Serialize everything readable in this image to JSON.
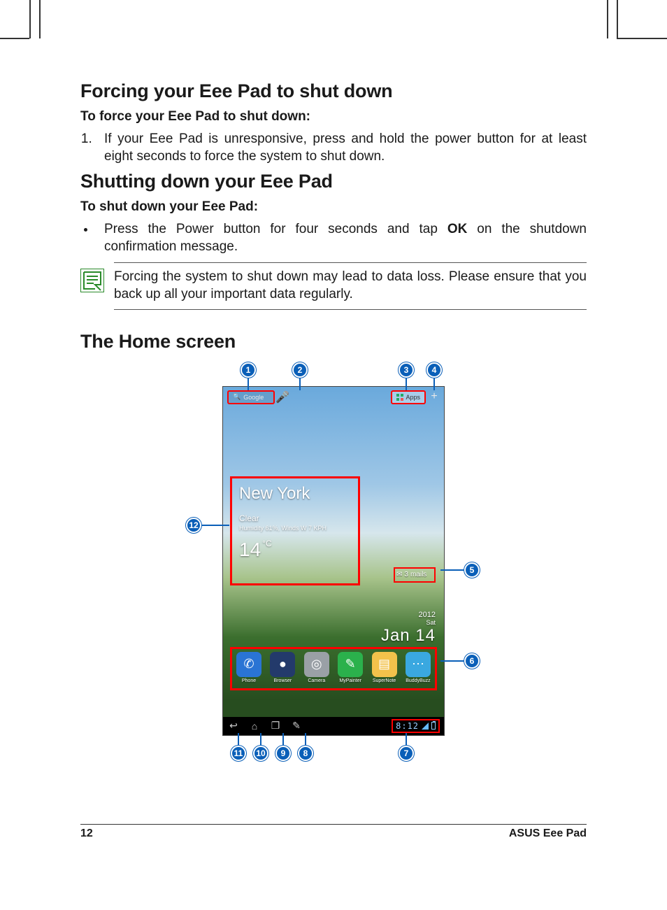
{
  "headings": {
    "forcing": "Forcing your Eee Pad to shut down",
    "force_sub": "To force your Eee Pad to shut down:",
    "shutting": "Shutting down your Eee Pad",
    "shut_sub": "To shut down your Eee Pad:",
    "home": "The Home screen"
  },
  "body": {
    "force_item": "If your Eee Pad is unresponsive, press and hold the power button for at least eight seconds to force the system to shut down.",
    "shut_item_pre": "Press the Power button for four seconds and tap ",
    "shut_item_bold": "OK",
    "shut_item_post": " on the shutdown confirmation message.",
    "note": "Forcing the system to shut down may lead to data loss. Please ensure that you back up all your important data regularly."
  },
  "callouts": [
    "1",
    "2",
    "3",
    "4",
    "5",
    "6",
    "7",
    "8",
    "9",
    "10",
    "11",
    "12"
  ],
  "screen": {
    "search_placeholder": "Google",
    "apps_label": "Apps",
    "weather": {
      "city": "New York",
      "condition": "Clear",
      "humidity": "Humidity 61%, Winds W 7 KPH",
      "temp_value": "14",
      "temp_unit": "°C"
    },
    "mails": {
      "count": "3",
      "label": "mails"
    },
    "date": {
      "year": "2012",
      "day": "Sat",
      "main": "Jan 14"
    },
    "dock": [
      {
        "name": "Phone",
        "color": "#2a74d4",
        "glyph": "✆"
      },
      {
        "name": "Browser",
        "color": "#233a6b",
        "glyph": "●"
      },
      {
        "name": "Camera",
        "color": "#9aa0a6",
        "glyph": "◎"
      },
      {
        "name": "MyPainter",
        "color": "#2bb14c",
        "glyph": "✎"
      },
      {
        "name": "SuperNote",
        "color": "#f2c24b",
        "glyph": "▤"
      },
      {
        "name": "BuddyBuzz",
        "color": "#3aa8e0",
        "glyph": "⋯"
      }
    ],
    "status_time": "8:12"
  },
  "footer": {
    "page": "12",
    "product": "ASUS Eee Pad"
  }
}
